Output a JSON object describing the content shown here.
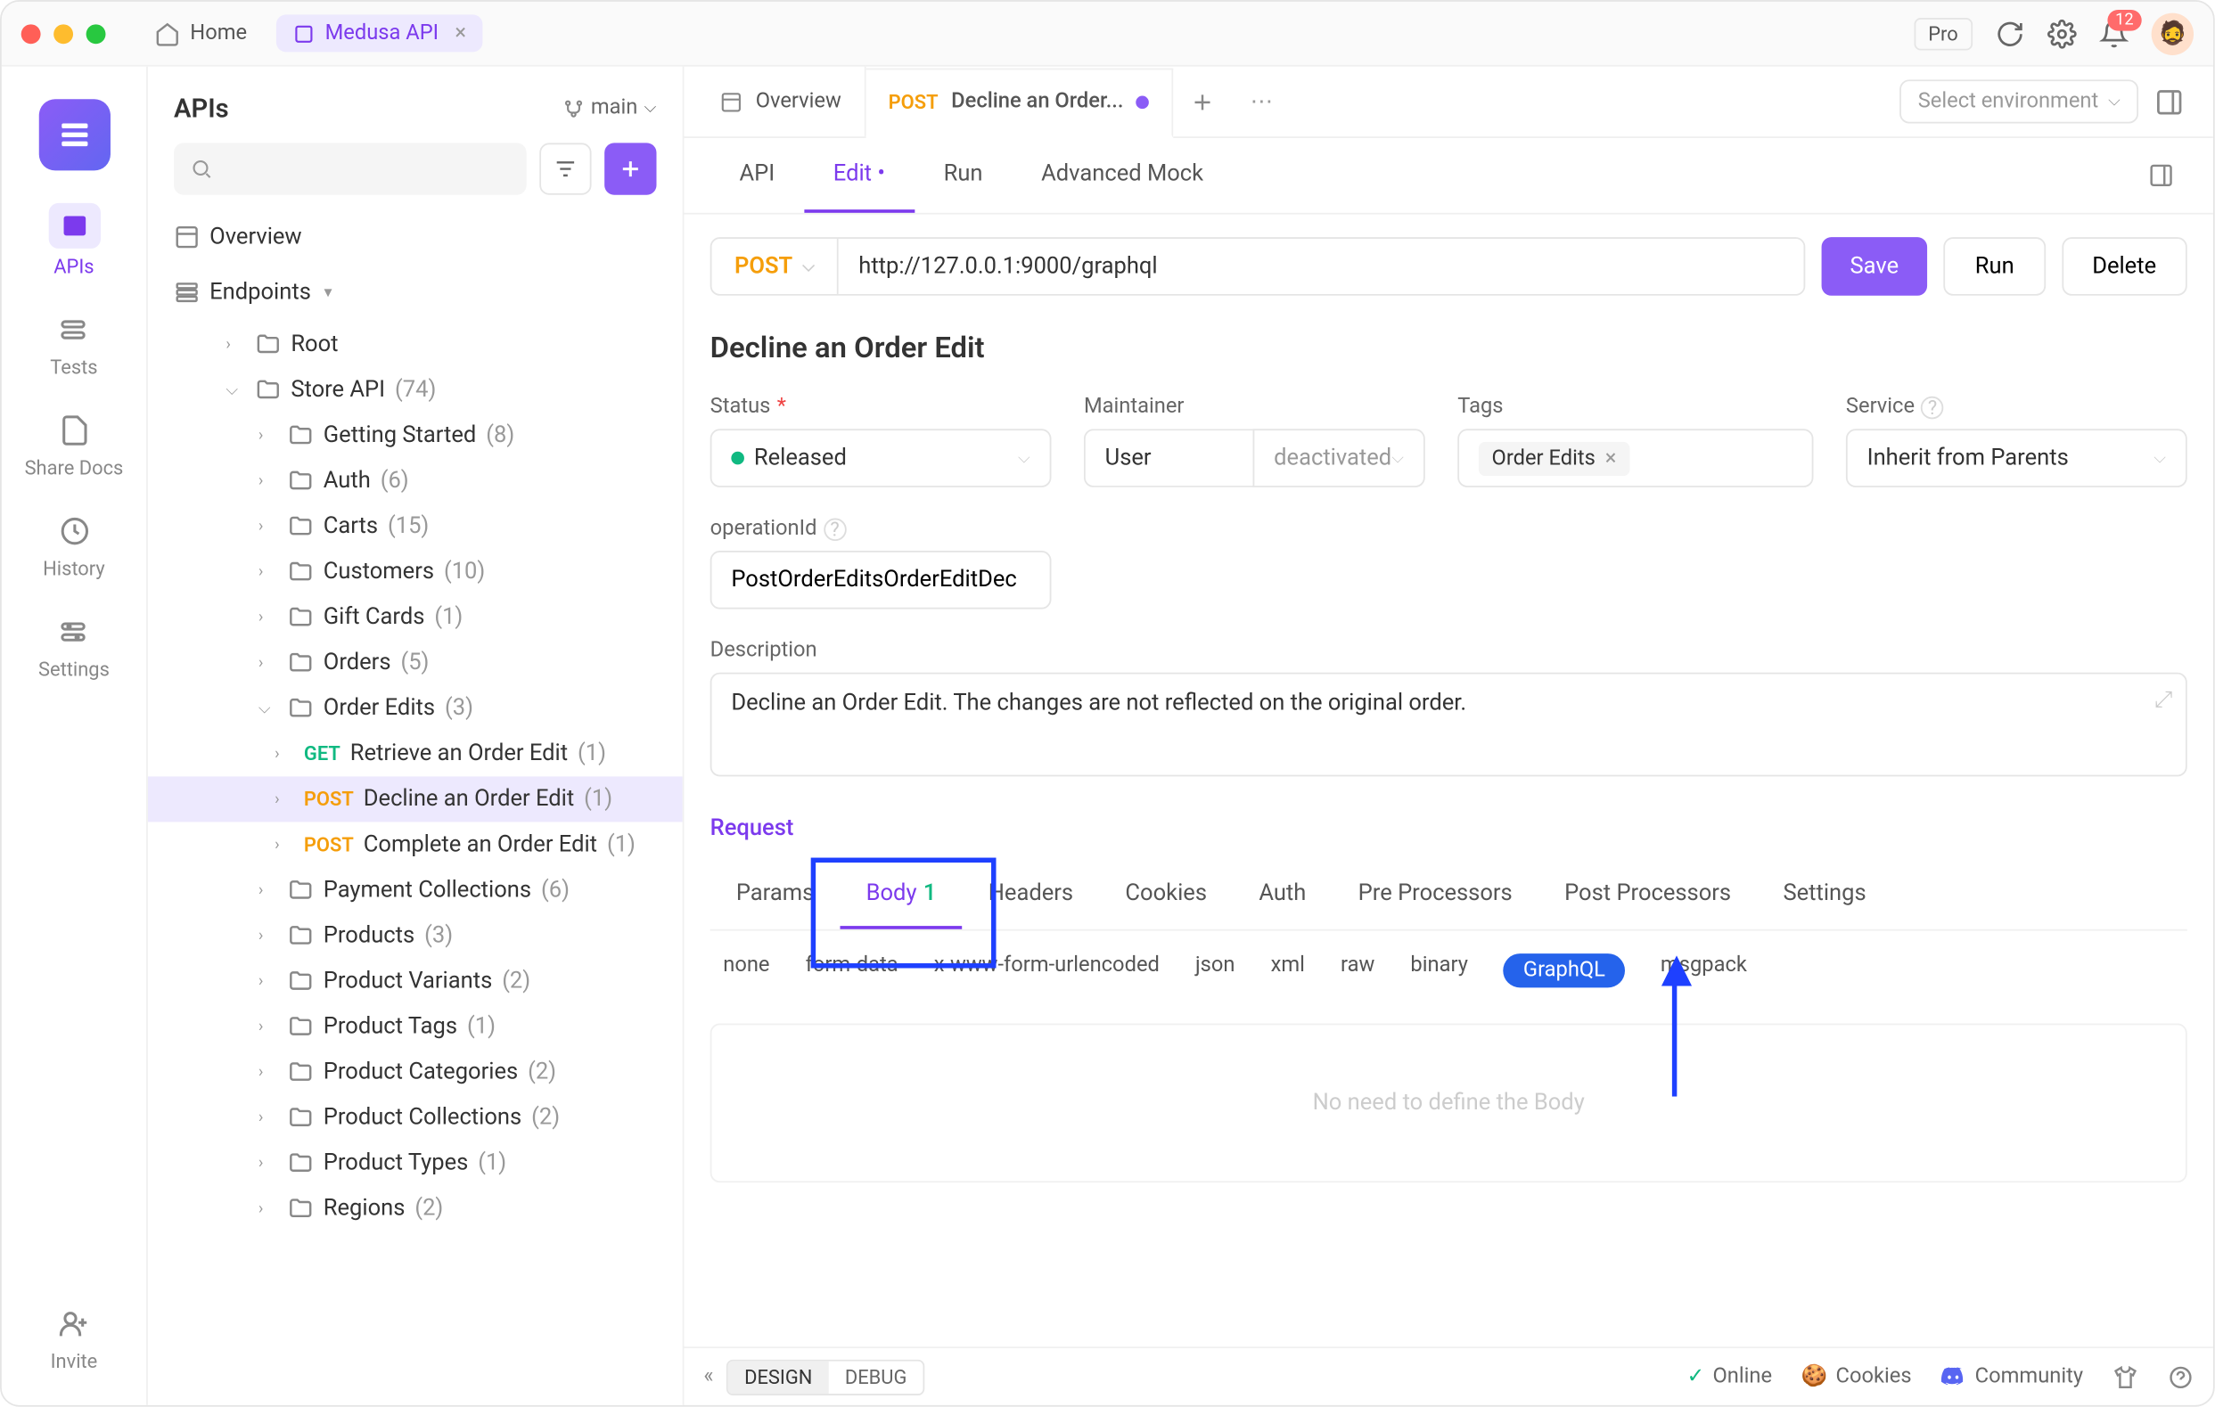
{
  "titlebar": {
    "home_label": "Home",
    "project_tab": "Medusa API",
    "pro_badge": "Pro",
    "notification_count": "12"
  },
  "rail": {
    "items": [
      {
        "label": "APIs"
      },
      {
        "label": "Tests"
      },
      {
        "label": "Share Docs"
      },
      {
        "label": "History"
      },
      {
        "label": "Settings"
      }
    ],
    "invite_label": "Invite"
  },
  "sidebar": {
    "title": "APIs",
    "branch": "main",
    "overview_label": "Overview",
    "endpoints_label": "Endpoints",
    "tree": [
      {
        "label": "Root",
        "indent": 2,
        "folder": true
      },
      {
        "label": "Store API",
        "count": "(74)",
        "indent": 2,
        "folder": true,
        "open": true
      },
      {
        "label": "Getting Started",
        "count": "(8)",
        "indent": 3,
        "folder": true
      },
      {
        "label": "Auth",
        "count": "(6)",
        "indent": 3,
        "folder": true
      },
      {
        "label": "Carts",
        "count": "(15)",
        "indent": 3,
        "folder": true
      },
      {
        "label": "Customers",
        "count": "(10)",
        "indent": 3,
        "folder": true
      },
      {
        "label": "Gift Cards",
        "count": "(1)",
        "indent": 3,
        "folder": true
      },
      {
        "label": "Orders",
        "count": "(5)",
        "indent": 3,
        "folder": true
      },
      {
        "label": "Order Edits",
        "count": "(3)",
        "indent": 3,
        "folder": true,
        "open": true
      },
      {
        "label": "Retrieve an Order Edit",
        "count": "(1)",
        "indent": 4,
        "method": "GET"
      },
      {
        "label": "Decline an Order Edit",
        "count": "(1)",
        "indent": 4,
        "method": "POST",
        "selected": true
      },
      {
        "label": "Complete an Order Edit",
        "count": "(1)",
        "indent": 4,
        "method": "POST"
      },
      {
        "label": "Payment Collections",
        "count": "(6)",
        "indent": 3,
        "folder": true
      },
      {
        "label": "Products",
        "count": "(3)",
        "indent": 3,
        "folder": true
      },
      {
        "label": "Product Variants",
        "count": "(2)",
        "indent": 3,
        "folder": true
      },
      {
        "label": "Product Tags",
        "count": "(1)",
        "indent": 3,
        "folder": true
      },
      {
        "label": "Product Categories",
        "count": "(2)",
        "indent": 3,
        "folder": true
      },
      {
        "label": "Product Collections",
        "count": "(2)",
        "indent": 3,
        "folder": true
      },
      {
        "label": "Product Types",
        "count": "(1)",
        "indent": 3,
        "folder": true
      },
      {
        "label": "Regions",
        "count": "(2)",
        "indent": 3,
        "folder": true
      }
    ]
  },
  "tabs": {
    "overview": "Overview",
    "active_method": "POST",
    "active_label": "Decline an Order...",
    "env_placeholder": "Select environment"
  },
  "subtabs": {
    "api": "API",
    "edit": "Edit",
    "run": "Run",
    "mock": "Advanced Mock"
  },
  "urlbar": {
    "method": "POST",
    "url": "http://127.0.0.1:9000/graphql",
    "save": "Save",
    "run": "Run",
    "delete": "Delete"
  },
  "form": {
    "title": "Decline an Order Edit",
    "status_label": "Status",
    "status_value": "Released",
    "maintainer_label": "Maintainer",
    "maintainer_value": "User",
    "maintainer_state": "deactivated",
    "tags_label": "Tags",
    "tags_value": "Order Edits",
    "service_label": "Service",
    "service_value": "Inherit from Parents",
    "opid_label": "operationId",
    "opid_value": "PostOrderEditsOrderEditDec",
    "desc_label": "Description",
    "desc_value": "Decline an Order Edit. The changes are not reflected on the original order."
  },
  "request": {
    "section": "Request",
    "tabs": [
      "Params",
      "Body",
      "Headers",
      "Cookies",
      "Auth",
      "Pre Processors",
      "Post Processors",
      "Settings"
    ],
    "body_count": "1",
    "body_types": [
      "none",
      "form-data",
      "x-www-form-urlencoded",
      "json",
      "xml",
      "raw",
      "binary",
      "GraphQL",
      "msgpack"
    ],
    "body_placeholder": "No need to define the Body"
  },
  "footer": {
    "design": "DESIGN",
    "debug": "DEBUG",
    "online": "Online",
    "cookies": "Cookies",
    "community": "Community"
  }
}
